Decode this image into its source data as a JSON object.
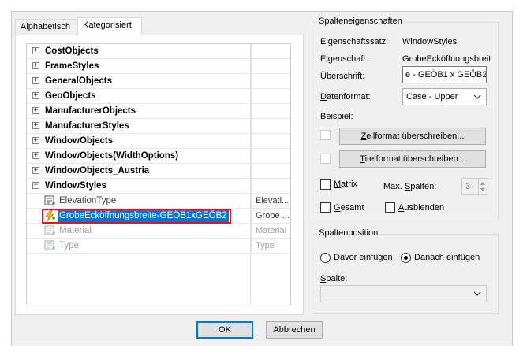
{
  "tabs": [
    {
      "label": "Alphabetisch",
      "active": false
    },
    {
      "label": "Kategorisiert",
      "active": true
    }
  ],
  "grid": {
    "categories": [
      {
        "label": "CostObjects",
        "expander": "+"
      },
      {
        "label": "FrameStyles",
        "expander": "+"
      },
      {
        "label": "GeneralObjects",
        "expander": "+"
      },
      {
        "label": "GeoObjects",
        "expander": "+"
      },
      {
        "label": "ManufacturerObjects",
        "expander": "+"
      },
      {
        "label": "ManufacturerStyles",
        "expander": "+"
      },
      {
        "label": "WindowObjects",
        "expander": "+"
      },
      {
        "label": "WindowObjects(WidthOptions)",
        "expander": "+"
      },
      {
        "label": "WindowObjects_Austria",
        "expander": "+"
      },
      {
        "label": "WindowStyles",
        "expander": "−"
      }
    ],
    "properties": [
      {
        "label": "ElevationType",
        "value": "Elevati...",
        "icon": "property-icon"
      },
      {
        "label": "GrobeEcköffnungsbreite-GEÖB1xGEÖB2",
        "value": "Grobe ...",
        "icon": "computed-property-icon"
      },
      {
        "label": "Material",
        "value": "Material",
        "icon": "property-icon"
      },
      {
        "label": "Type",
        "value": "Type",
        "icon": "property-icon"
      }
    ]
  },
  "spalteneigenschaften": {
    "title": "Spalteneigenschaften",
    "eigenschaftssatz_label": "Eigenschaftssatz:",
    "eigenschaftssatz_value": "WindowStyles",
    "eigenschaft_label": "Eigenschaft:",
    "eigenschaft_value": "GrobeEcköffnungsbreit",
    "ueberschrift_label": "Überschrift:",
    "ueberschrift_value": "e - GEÖB1 x GEÖB2",
    "datenformat_label": "Datenformat:",
    "datenformat_value": "Case - Upper",
    "beispiel_label": "Beispiel:",
    "zellformat_button": "Zellformat überschreiben...",
    "titelformat_button": "Titelformat überschreiben...",
    "matrix_label": "Matrix",
    "max_spalten_label": "Max. Spalten:",
    "max_spalten_value": "3",
    "gesamt_label": "Gesamt",
    "ausblenden_label": "Ausblenden"
  },
  "spaltenposition": {
    "title": "Spaltenposition",
    "davor_label": "Davor einfügen",
    "danach_label": "Danach einfügen",
    "spalte_label": "Spalte:",
    "spalte_value": ""
  },
  "buttons": {
    "ok": "OK",
    "abbrechen": "Abbrechen"
  },
  "colors": {
    "selection": "#0078d7",
    "highlight_outline": "#e81123",
    "dialog_bg": "#f0f0f0"
  }
}
